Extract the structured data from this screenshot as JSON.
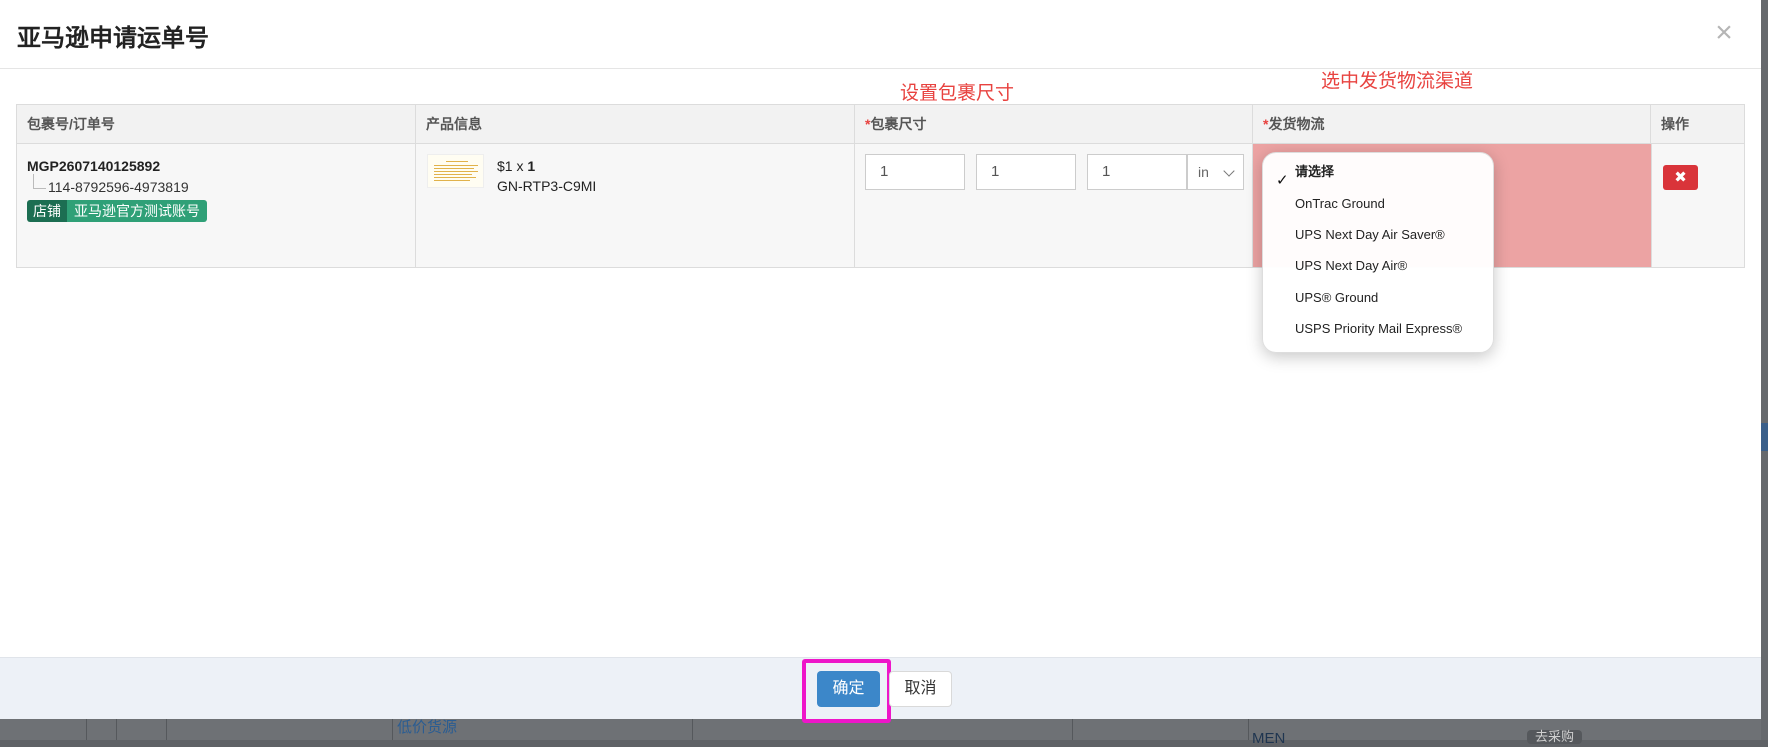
{
  "modal": {
    "title": "亚马逊申请运单号",
    "close_glyph": "×"
  },
  "annotations": {
    "dimensions_note": "设置包裹尺寸",
    "shipping_note": "选中发货物流渠道"
  },
  "table": {
    "headers": {
      "package": "包裹号/订单号",
      "product": "产品信息",
      "dimensions_star": "*",
      "dimensions": "包裹尺寸",
      "shipping_star": "*",
      "shipping": "发货物流",
      "action": "操作"
    },
    "row": {
      "package_no": "MGP2607140125892",
      "order_no": "114-8792596-4973819",
      "store_label": "店铺",
      "store_name": "亚马逊官方测试账号",
      "price_qty": "$1 x ",
      "qty": "1",
      "sku": "GN-RTP3-C9MI",
      "length": "1",
      "width": "1",
      "height": "1",
      "unit": "in",
      "delete_glyph": "✖"
    }
  },
  "shipping_dropdown": {
    "check_glyph": "✓",
    "options": [
      "请选择",
      "OnTrac Ground",
      "UPS Next Day Air Saver®",
      "UPS Next Day Air®",
      "UPS® Ground",
      "USPS Priority Mail Express®"
    ]
  },
  "footer": {
    "ok_label": "确定",
    "cancel_label": "取消"
  },
  "background_page": {
    "link_text": "低价货源",
    "text_1": "MEN",
    "pill_1": "去采购"
  },
  "colors": {
    "required": "#e8423f",
    "store_badge_dark": "#1c6e52",
    "store_badge_light": "#2fa077",
    "ok_button": "#3c87c9",
    "highlight_box": "#ee15c9",
    "shipping_cell": "#eca3a3",
    "delete_button": "#d9343a"
  },
  "icons": {
    "copy": "copy-icon",
    "close": "close-icon",
    "delete": "delete-icon",
    "check": "checkmark-icon",
    "chevron": "chevron-down-icon"
  }
}
